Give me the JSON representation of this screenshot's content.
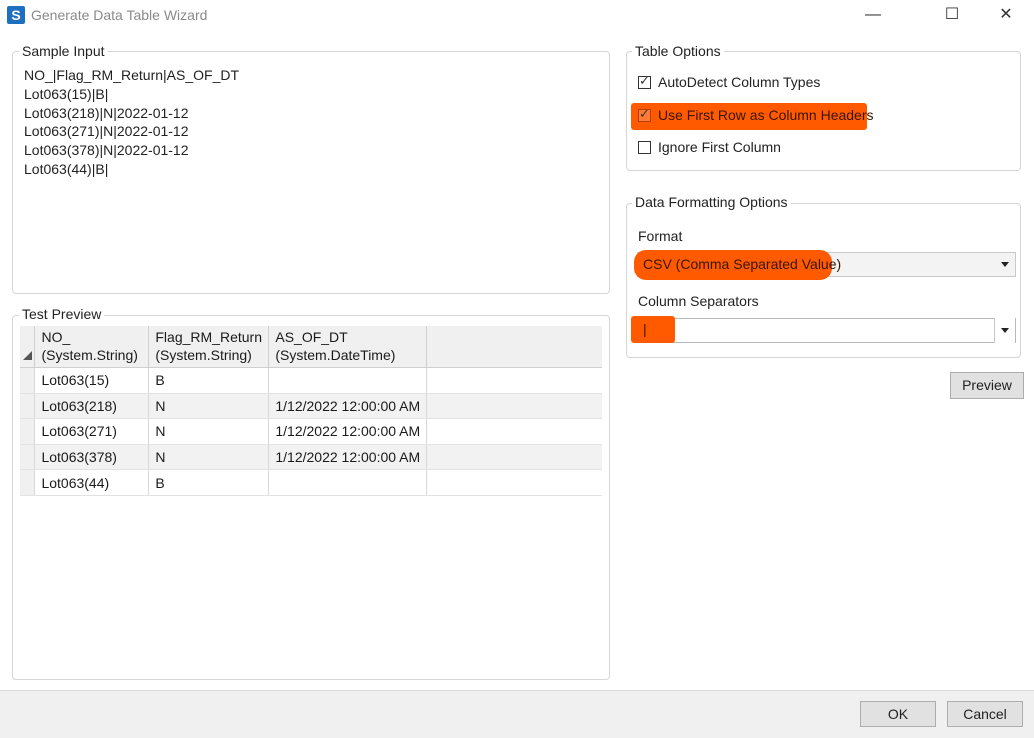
{
  "window": {
    "title": "Generate Data Table Wizard",
    "app_icon_glyph": "S",
    "minimize_glyph": "—",
    "maximize_glyph": "☐",
    "close_glyph": "✕"
  },
  "sample_input": {
    "legend": "Sample Input",
    "lines": [
      "NO_|Flag_RM_Return|AS_OF_DT",
      "Lot063(15)|B|",
      "Lot063(218)|N|2022-01-12",
      "Lot063(271)|N|2022-01-12",
      "Lot063(378)|N|2022-01-12",
      "Lot063(44)|B|"
    ]
  },
  "test_preview": {
    "legend": "Test Preview",
    "columns": [
      {
        "name": "NO_",
        "type": "(System.String)"
      },
      {
        "name": "Flag_RM_Return",
        "type": "(System.String)"
      },
      {
        "name": "AS_OF_DT",
        "type": "(System.DateTime)"
      }
    ],
    "rows": [
      [
        "Lot063(15)",
        "B",
        ""
      ],
      [
        "Lot063(218)",
        "N",
        "1/12/2022 12:00:00 AM"
      ],
      [
        "Lot063(271)",
        "N",
        "1/12/2022 12:00:00 AM"
      ],
      [
        "Lot063(378)",
        "N",
        "1/12/2022 12:00:00 AM"
      ],
      [
        "Lot063(44)",
        "B",
        ""
      ]
    ]
  },
  "table_options": {
    "legend": "Table Options",
    "autodetect": {
      "label": "AutoDetect Column Types",
      "checked": true
    },
    "first_row_headers": {
      "label": "Use First Row as Column Headers",
      "checked": true
    },
    "ignore_first_column": {
      "label": "Ignore First Column",
      "checked": false
    }
  },
  "data_formatting": {
    "legend": "Data Formatting Options",
    "format_label": "Format",
    "format_value": "CSV (Comma Separated Value)",
    "separators_label": "Column Separators",
    "separators_value": "|"
  },
  "buttons": {
    "preview": "Preview",
    "ok": "OK",
    "cancel": "Cancel"
  },
  "colors": {
    "highlight": "#ff5a00",
    "app_icon": "#1e6fbf"
  }
}
